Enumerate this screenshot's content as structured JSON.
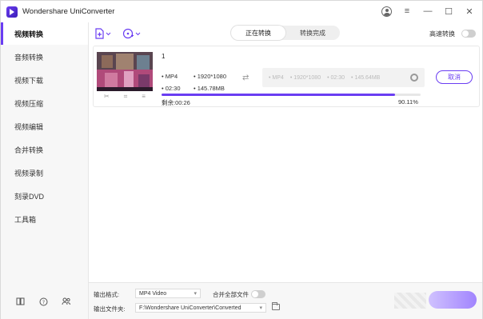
{
  "app": {
    "title": "Wondershare UniConverter"
  },
  "sidebar": {
    "items": [
      {
        "label": "视频转换",
        "active": true
      },
      {
        "label": "音频转换"
      },
      {
        "label": "视频下载"
      },
      {
        "label": "视频压缩"
      },
      {
        "label": "视频编辑"
      },
      {
        "label": "合并转换"
      },
      {
        "label": "视频录制"
      },
      {
        "label": "刻录DVD"
      },
      {
        "label": "工具箱"
      }
    ],
    "bottom_icons": [
      "book-icon",
      "help-icon",
      "users-icon"
    ]
  },
  "toolbar": {
    "tabs": [
      {
        "label": "正在转换",
        "active": true
      },
      {
        "label": "转换完成"
      }
    ],
    "high_speed_label": "高速转换"
  },
  "task": {
    "name": "1",
    "source": {
      "format": "MP4",
      "resolution": "1920*1080",
      "duration": "02:30",
      "size": "145.78MB"
    },
    "target": {
      "format": "MP4",
      "resolution": "1920*1080",
      "duration": "02:30",
      "size": "145.64MB"
    },
    "cancel_label": "取消",
    "remaining": "剩余:00:26",
    "progress_percent": 90.11,
    "progress_text": "90.11%"
  },
  "bottom": {
    "format_label": "输出格式:",
    "format_value": "MP4 Video",
    "merge_label": "合并全部文件",
    "folder_label": "输出文件夹:",
    "folder_value": "F:\\Wondershare UniConverter\\Converted"
  },
  "colors": {
    "accent": "#6a3df2"
  }
}
